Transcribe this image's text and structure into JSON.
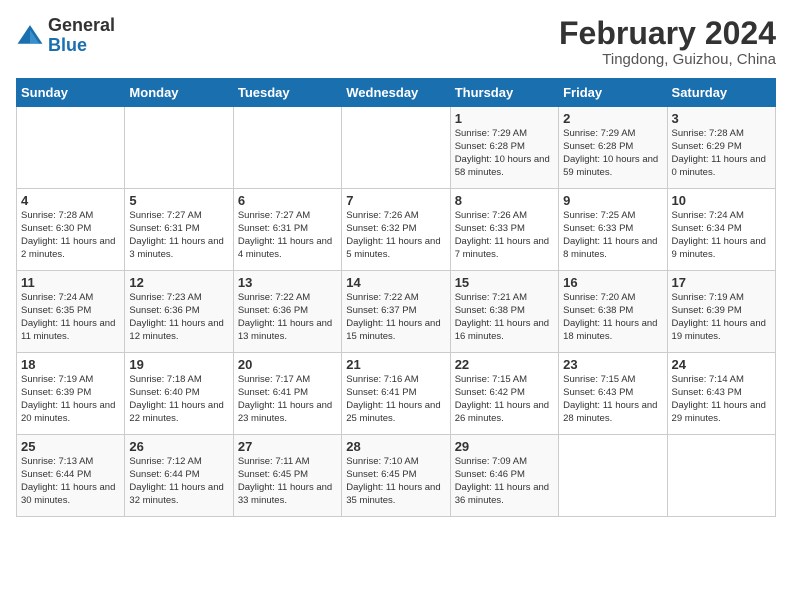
{
  "logo": {
    "general": "General",
    "blue": "Blue"
  },
  "header": {
    "month_year": "February 2024",
    "location": "Tingdong, Guizhou, China"
  },
  "weekdays": [
    "Sunday",
    "Monday",
    "Tuesday",
    "Wednesday",
    "Thursday",
    "Friday",
    "Saturday"
  ],
  "weeks": [
    [
      {
        "day": "",
        "info": ""
      },
      {
        "day": "",
        "info": ""
      },
      {
        "day": "",
        "info": ""
      },
      {
        "day": "",
        "info": ""
      },
      {
        "day": "1",
        "info": "Sunrise: 7:29 AM\nSunset: 6:28 PM\nDaylight: 10 hours\nand 58 minutes."
      },
      {
        "day": "2",
        "info": "Sunrise: 7:29 AM\nSunset: 6:28 PM\nDaylight: 10 hours\nand 59 minutes."
      },
      {
        "day": "3",
        "info": "Sunrise: 7:28 AM\nSunset: 6:29 PM\nDaylight: 11 hours\nand 0 minutes."
      }
    ],
    [
      {
        "day": "4",
        "info": "Sunrise: 7:28 AM\nSunset: 6:30 PM\nDaylight: 11 hours\nand 2 minutes."
      },
      {
        "day": "5",
        "info": "Sunrise: 7:27 AM\nSunset: 6:31 PM\nDaylight: 11 hours\nand 3 minutes."
      },
      {
        "day": "6",
        "info": "Sunrise: 7:27 AM\nSunset: 6:31 PM\nDaylight: 11 hours\nand 4 minutes."
      },
      {
        "day": "7",
        "info": "Sunrise: 7:26 AM\nSunset: 6:32 PM\nDaylight: 11 hours\nand 5 minutes."
      },
      {
        "day": "8",
        "info": "Sunrise: 7:26 AM\nSunset: 6:33 PM\nDaylight: 11 hours\nand 7 minutes."
      },
      {
        "day": "9",
        "info": "Sunrise: 7:25 AM\nSunset: 6:33 PM\nDaylight: 11 hours\nand 8 minutes."
      },
      {
        "day": "10",
        "info": "Sunrise: 7:24 AM\nSunset: 6:34 PM\nDaylight: 11 hours\nand 9 minutes."
      }
    ],
    [
      {
        "day": "11",
        "info": "Sunrise: 7:24 AM\nSunset: 6:35 PM\nDaylight: 11 hours\nand 11 minutes."
      },
      {
        "day": "12",
        "info": "Sunrise: 7:23 AM\nSunset: 6:36 PM\nDaylight: 11 hours\nand 12 minutes."
      },
      {
        "day": "13",
        "info": "Sunrise: 7:22 AM\nSunset: 6:36 PM\nDaylight: 11 hours\nand 13 minutes."
      },
      {
        "day": "14",
        "info": "Sunrise: 7:22 AM\nSunset: 6:37 PM\nDaylight: 11 hours\nand 15 minutes."
      },
      {
        "day": "15",
        "info": "Sunrise: 7:21 AM\nSunset: 6:38 PM\nDaylight: 11 hours\nand 16 minutes."
      },
      {
        "day": "16",
        "info": "Sunrise: 7:20 AM\nSunset: 6:38 PM\nDaylight: 11 hours\nand 18 minutes."
      },
      {
        "day": "17",
        "info": "Sunrise: 7:19 AM\nSunset: 6:39 PM\nDaylight: 11 hours\nand 19 minutes."
      }
    ],
    [
      {
        "day": "18",
        "info": "Sunrise: 7:19 AM\nSunset: 6:39 PM\nDaylight: 11 hours\nand 20 minutes."
      },
      {
        "day": "19",
        "info": "Sunrise: 7:18 AM\nSunset: 6:40 PM\nDaylight: 11 hours\nand 22 minutes."
      },
      {
        "day": "20",
        "info": "Sunrise: 7:17 AM\nSunset: 6:41 PM\nDaylight: 11 hours\nand 23 minutes."
      },
      {
        "day": "21",
        "info": "Sunrise: 7:16 AM\nSunset: 6:41 PM\nDaylight: 11 hours\nand 25 minutes."
      },
      {
        "day": "22",
        "info": "Sunrise: 7:15 AM\nSunset: 6:42 PM\nDaylight: 11 hours\nand 26 minutes."
      },
      {
        "day": "23",
        "info": "Sunrise: 7:15 AM\nSunset: 6:43 PM\nDaylight: 11 hours\nand 28 minutes."
      },
      {
        "day": "24",
        "info": "Sunrise: 7:14 AM\nSunset: 6:43 PM\nDaylight: 11 hours\nand 29 minutes."
      }
    ],
    [
      {
        "day": "25",
        "info": "Sunrise: 7:13 AM\nSunset: 6:44 PM\nDaylight: 11 hours\nand 30 minutes."
      },
      {
        "day": "26",
        "info": "Sunrise: 7:12 AM\nSunset: 6:44 PM\nDaylight: 11 hours\nand 32 minutes."
      },
      {
        "day": "27",
        "info": "Sunrise: 7:11 AM\nSunset: 6:45 PM\nDaylight: 11 hours\nand 33 minutes."
      },
      {
        "day": "28",
        "info": "Sunrise: 7:10 AM\nSunset: 6:45 PM\nDaylight: 11 hours\nand 35 minutes."
      },
      {
        "day": "29",
        "info": "Sunrise: 7:09 AM\nSunset: 6:46 PM\nDaylight: 11 hours\nand 36 minutes."
      },
      {
        "day": "",
        "info": ""
      },
      {
        "day": "",
        "info": ""
      }
    ]
  ]
}
